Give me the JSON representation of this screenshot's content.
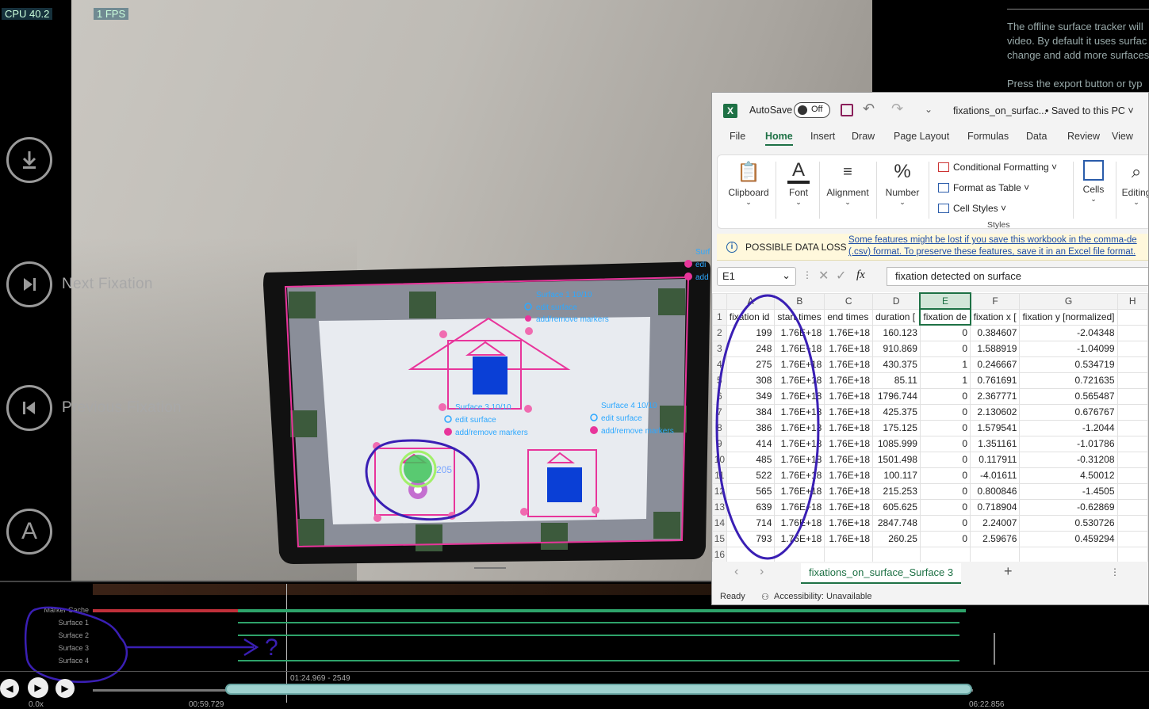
{
  "stats": {
    "cpu": "CPU 40.2",
    "fps": "1 FPS"
  },
  "controls": {
    "download_icon": "download-icon",
    "next_fixation_label": "Next Fixation",
    "previous_fixation_label": "Previous Fixation",
    "annotation_letter": "A"
  },
  "right_panel": {
    "lines": [
      "The offline surface tracker will",
      "video. By default it uses surfac",
      "change and add more surfaces",
      "Press the export button or typ"
    ]
  },
  "surfaces_overlay": {
    "surface1_title": "Surface 1  10/10",
    "surface3_title": "Surface 3  10/10",
    "surface4_title": "Surface 4  10/10",
    "surface_right_title": "Surf",
    "edit_surface": "edit surface",
    "add_remove_markers": "add/remove markers",
    "edit_short": "edi",
    "add_short": "add",
    "gaze_label": "205"
  },
  "timeline": {
    "rows": [
      "Marker Cache",
      "Surface 1",
      "Surface 2",
      "Surface 3",
      "Surface 4"
    ],
    "annotation_mark": "?",
    "range_label": "01:24.969 - 2549",
    "speed": "0.0x",
    "current_time": "00:59.729",
    "end_time": "06:22.856"
  },
  "excel": {
    "autosave_label": "AutoSave",
    "autosave_state": "Off",
    "file_name": "fixations_on_surfac...",
    "save_status": "• Saved to this PC ˅",
    "tabs": [
      "File",
      "Home",
      "Insert",
      "Draw",
      "Page Layout",
      "Formulas",
      "Data",
      "Review",
      "View"
    ],
    "active_tab": "Home",
    "ribbon": {
      "clipboard": "Clipboard",
      "font": "Font",
      "alignment": "Alignment",
      "number": "Number",
      "conditional_formatting": "Conditional Formatting ˅",
      "format_as_table": "Format as Table ˅",
      "cell_styles": "Cell Styles ˅",
      "styles": "Styles",
      "cells": "Cells",
      "editing": "Editing"
    },
    "warning": {
      "title": "POSSIBLE DATA LOSS",
      "line1": "Some features might be lost if you save this workbook in the comma-de",
      "line2": "(.csv) format. To preserve these features, save it in an Excel file format."
    },
    "name_box": "E1",
    "formula": "fixation detected on surface",
    "fx": "fx",
    "columns": [
      "A",
      "B",
      "C",
      "D",
      "E",
      "F",
      "G",
      "H"
    ],
    "header_row": [
      "fixation id",
      "start times",
      "end times",
      "duration [",
      "fixation de",
      "fixation x [",
      "fixation y [normalized]",
      ""
    ],
    "rows": [
      [
        "199",
        "1.76E+18",
        "1.76E+18",
        "160.123",
        "0",
        "0.384607",
        "-2.04348"
      ],
      [
        "248",
        "1.76E+18",
        "1.76E+18",
        "910.869",
        "0",
        "1.588919",
        "-1.04099"
      ],
      [
        "275",
        "1.76E+18",
        "1.76E+18",
        "430.375",
        "1",
        "0.246667",
        "0.534719"
      ],
      [
        "308",
        "1.76E+18",
        "1.76E+18",
        "85.11",
        "1",
        "0.761691",
        "0.721635"
      ],
      [
        "349",
        "1.76E+18",
        "1.76E+18",
        "1796.744",
        "0",
        "2.367771",
        "0.565487"
      ],
      [
        "384",
        "1.76E+18",
        "1.76E+18",
        "425.375",
        "0",
        "2.130602",
        "0.676767"
      ],
      [
        "386",
        "1.76E+18",
        "1.76E+18",
        "175.125",
        "0",
        "1.579541",
        "-1.2044"
      ],
      [
        "414",
        "1.76E+18",
        "1.76E+18",
        "1085.999",
        "0",
        "1.351161",
        "-1.01786"
      ],
      [
        "485",
        "1.76E+18",
        "1.76E+18",
        "1501.498",
        "0",
        "0.117911",
        "-0.31208"
      ],
      [
        "522",
        "1.76E+18",
        "1.76E+18",
        "100.117",
        "0",
        "-4.01611",
        "4.50012"
      ],
      [
        "565",
        "1.76E+18",
        "1.76E+18",
        "215.253",
        "0",
        "0.800846",
        "-1.4505"
      ],
      [
        "639",
        "1.76E+18",
        "1.76E+18",
        "605.625",
        "0",
        "0.718904",
        "-0.62869"
      ],
      [
        "714",
        "1.76E+18",
        "1.76E+18",
        "2847.748",
        "0",
        "2.24007",
        "0.530726"
      ],
      [
        "793",
        "1.76E+18",
        "1.76E+18",
        "260.25",
        "0",
        "2.59676",
        "0.459294"
      ]
    ],
    "sheet_tab": "fixations_on_surface_Surface 3",
    "status_ready": "Ready",
    "status_accessibility": "Accessibility: Unavailable",
    "colors": {
      "accent": "#1e7145",
      "annotation": "#3a1fb4",
      "surface": "#e8359b",
      "marker_cache": "#c0303a",
      "surface_bar": "#2ea36a"
    }
  }
}
